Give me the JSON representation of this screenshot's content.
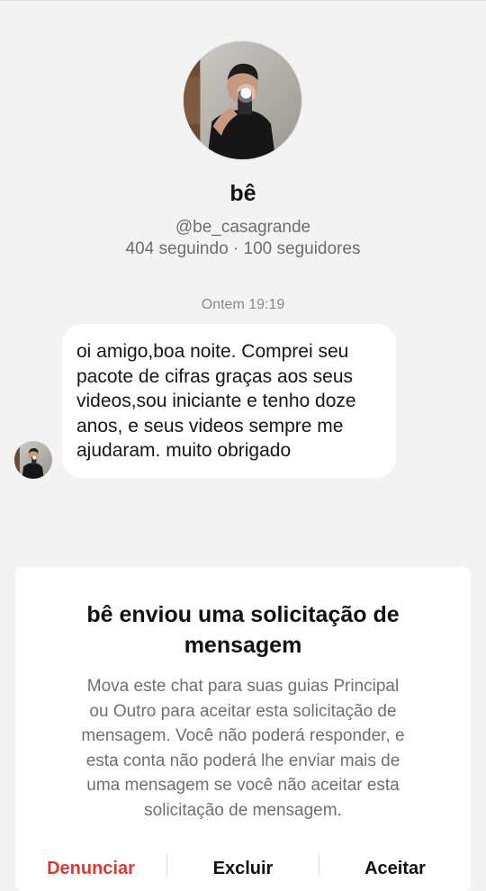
{
  "profile": {
    "name": "bê",
    "handle": "@be_casagrande",
    "stats": "404 seguindo · 100 seguidores"
  },
  "chat": {
    "timestamp": "Ontem 19:19",
    "message_lines": [
      "oi amigo,boa noite. Comprei seu",
      "pacote de cifras graças aos seus",
      "videos,sou iniciante e tenho doze",
      "anos, e seus videos sempre me",
      "ajudaram. muito obrigado"
    ]
  },
  "request": {
    "title_lines": [
      "bê enviou uma solicitação de",
      "mensagem"
    ],
    "body_lines": [
      "Mova este chat para suas guias Principal",
      "ou Outro para aceitar esta solicitação de",
      "mensagem. Você não poderá responder, e",
      "esta conta não poderá lhe enviar mais de",
      "uma mensagem se você não aceitar esta",
      "solicitação de mensagem."
    ],
    "actions": {
      "report": "Denunciar",
      "delete": "Excluir",
      "accept": "Aceitar"
    }
  },
  "colors": {
    "background": "#f3f3f3",
    "report_red": "#e0382e"
  },
  "icons": {
    "avatar": "profile-photo"
  }
}
